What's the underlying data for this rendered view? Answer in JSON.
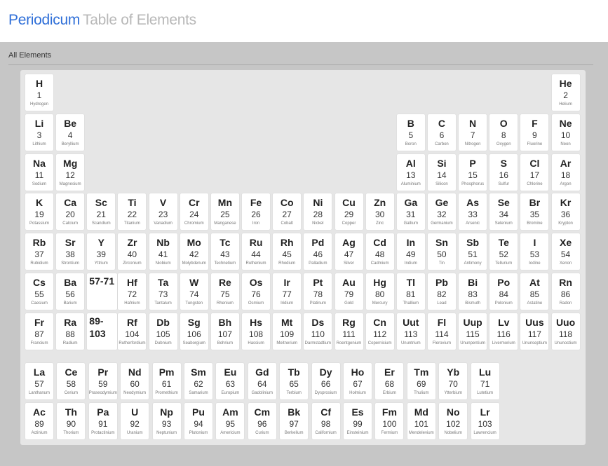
{
  "header": {
    "title": "Periodicum",
    "subtitle": "Table of Elements"
  },
  "section": {
    "title": "All Elements"
  },
  "elements": [
    [
      "H",
      1,
      "Hydrogen",
      1,
      1
    ],
    [
      "He",
      2,
      "Helium",
      1,
      18
    ],
    [
      "Li",
      3,
      "Lithium",
      2,
      1
    ],
    [
      "Be",
      4,
      "Beryllium",
      2,
      2
    ],
    [
      "B",
      5,
      "Boron",
      2,
      13
    ],
    [
      "C",
      6,
      "Carbon",
      2,
      14
    ],
    [
      "N",
      7,
      "Nitrogen",
      2,
      15
    ],
    [
      "O",
      8,
      "Oxygen",
      2,
      16
    ],
    [
      "F",
      9,
      "Fluorine",
      2,
      17
    ],
    [
      "Ne",
      10,
      "Neon",
      2,
      18
    ],
    [
      "Na",
      11,
      "Sodium",
      3,
      1
    ],
    [
      "Mg",
      12,
      "Magnesium",
      3,
      2
    ],
    [
      "Al",
      13,
      "Aluminium",
      3,
      13
    ],
    [
      "Si",
      14,
      "Silicon",
      3,
      14
    ],
    [
      "P",
      15,
      "Phosphorus",
      3,
      15
    ],
    [
      "S",
      16,
      "Sulfur",
      3,
      16
    ],
    [
      "Cl",
      17,
      "Chlorine",
      3,
      17
    ],
    [
      "Ar",
      18,
      "Argon",
      3,
      18
    ],
    [
      "K",
      19,
      "Potassium",
      4,
      1
    ],
    [
      "Ca",
      20,
      "Calcium",
      4,
      2
    ],
    [
      "Sc",
      21,
      "Scandium",
      4,
      3
    ],
    [
      "Ti",
      22,
      "Titanium",
      4,
      4
    ],
    [
      "V",
      23,
      "Vanadium",
      4,
      5
    ],
    [
      "Cr",
      24,
      "Chromium",
      4,
      6
    ],
    [
      "Mn",
      25,
      "Manganese",
      4,
      7
    ],
    [
      "Fe",
      26,
      "Iron",
      4,
      8
    ],
    [
      "Co",
      27,
      "Cobalt",
      4,
      9
    ],
    [
      "Ni",
      28,
      "Nickel",
      4,
      10
    ],
    [
      "Cu",
      29,
      "Copper",
      4,
      11
    ],
    [
      "Zn",
      30,
      "Zinc",
      4,
      12
    ],
    [
      "Ga",
      31,
      "Gallium",
      4,
      13
    ],
    [
      "Ge",
      32,
      "Germanium",
      4,
      14
    ],
    [
      "As",
      33,
      "Arsenic",
      4,
      15
    ],
    [
      "Se",
      34,
      "Selenium",
      4,
      16
    ],
    [
      "Br",
      35,
      "Bromine",
      4,
      17
    ],
    [
      "Kr",
      36,
      "Krypton",
      4,
      18
    ],
    [
      "Rb",
      37,
      "Rubidium",
      5,
      1
    ],
    [
      "Sr",
      38,
      "Strontium",
      5,
      2
    ],
    [
      "Y",
      39,
      "Yttrium",
      5,
      3
    ],
    [
      "Zr",
      40,
      "Zirconium",
      5,
      4
    ],
    [
      "Nb",
      41,
      "Niobium",
      5,
      5
    ],
    [
      "Mo",
      42,
      "Molybdenum",
      5,
      6
    ],
    [
      "Tc",
      43,
      "Technetium",
      5,
      7
    ],
    [
      "Ru",
      44,
      "Ruthenium",
      5,
      8
    ],
    [
      "Rh",
      45,
      "Rhodium",
      5,
      9
    ],
    [
      "Pd",
      46,
      "Palladium",
      5,
      10
    ],
    [
      "Ag",
      47,
      "Silver",
      5,
      11
    ],
    [
      "Cd",
      48,
      "Cadmium",
      5,
      12
    ],
    [
      "In",
      49,
      "Indium",
      5,
      13
    ],
    [
      "Sn",
      50,
      "Tin",
      5,
      14
    ],
    [
      "Sb",
      51,
      "Antimony",
      5,
      15
    ],
    [
      "Te",
      52,
      "Tellurium",
      5,
      16
    ],
    [
      "I",
      53,
      "Iodine",
      5,
      17
    ],
    [
      "Xe",
      54,
      "Xenon",
      5,
      18
    ],
    [
      "Cs",
      55,
      "Caesium",
      6,
      1
    ],
    [
      "Ba",
      56,
      "Barium",
      6,
      2
    ],
    [
      "Hf",
      72,
      "Hafnium",
      6,
      4
    ],
    [
      "Ta",
      73,
      "Tantalum",
      6,
      5
    ],
    [
      "W",
      74,
      "Tungsten",
      6,
      6
    ],
    [
      "Re",
      75,
      "Rhenium",
      6,
      7
    ],
    [
      "Os",
      76,
      "Osmium",
      6,
      8
    ],
    [
      "Ir",
      77,
      "Iridium",
      6,
      9
    ],
    [
      "Pt",
      78,
      "Platinum",
      6,
      10
    ],
    [
      "Au",
      79,
      "Gold",
      6,
      11
    ],
    [
      "Hg",
      80,
      "Mercury",
      6,
      12
    ],
    [
      "Tl",
      81,
      "Thallium",
      6,
      13
    ],
    [
      "Pb",
      82,
      "Lead",
      6,
      14
    ],
    [
      "Bi",
      83,
      "Bismuth",
      6,
      15
    ],
    [
      "Po",
      84,
      "Polonium",
      6,
      16
    ],
    [
      "At",
      85,
      "Astatine",
      6,
      17
    ],
    [
      "Rn",
      86,
      "Radon",
      6,
      18
    ],
    [
      "Fr",
      87,
      "Francium",
      7,
      1
    ],
    [
      "Ra",
      88,
      "Radium",
      7,
      2
    ],
    [
      "Rf",
      104,
      "Rutherfordium",
      7,
      4
    ],
    [
      "Db",
      105,
      "Dubnium",
      7,
      5
    ],
    [
      "Sg",
      106,
      "Seaborgium",
      7,
      6
    ],
    [
      "Bh",
      107,
      "Bohrium",
      7,
      7
    ],
    [
      "Hs",
      108,
      "Hassium",
      7,
      8
    ],
    [
      "Mt",
      109,
      "Meitnerium",
      7,
      9
    ],
    [
      "Ds",
      110,
      "Darmstadtium",
      7,
      10
    ],
    [
      "Rg",
      111,
      "Roentgenium",
      7,
      11
    ],
    [
      "Cn",
      112,
      "Copernicium",
      7,
      12
    ],
    [
      "Uut",
      113,
      "Ununtrium",
      7,
      13
    ],
    [
      "Fl",
      114,
      "Flerovium",
      7,
      14
    ],
    [
      "Uup",
      115,
      "Ununpentium",
      7,
      15
    ],
    [
      "Lv",
      116,
      "Livermorium",
      7,
      16
    ],
    [
      "Uus",
      117,
      "Ununseptium",
      7,
      17
    ],
    [
      "Uuo",
      118,
      "Ununoctium",
      7,
      18
    ],
    [
      "La",
      57,
      "Lanthanum",
      8,
      1
    ],
    [
      "Ce",
      58,
      "Cerium",
      8,
      2
    ],
    [
      "Pr",
      59,
      "Praseodymium",
      8,
      3
    ],
    [
      "Nd",
      60,
      "Neodymium",
      8,
      4
    ],
    [
      "Pm",
      61,
      "Promethium",
      8,
      5
    ],
    [
      "Sm",
      62,
      "Samarium",
      8,
      6
    ],
    [
      "Eu",
      63,
      "Europium",
      8,
      7
    ],
    [
      "Gd",
      64,
      "Gadolinium",
      8,
      8
    ],
    [
      "Tb",
      65,
      "Terbium",
      8,
      9
    ],
    [
      "Dy",
      66,
      "Dysprosium",
      8,
      10
    ],
    [
      "Ho",
      67,
      "Holmium",
      8,
      11
    ],
    [
      "Er",
      68,
      "Erbium",
      8,
      12
    ],
    [
      "Tm",
      69,
      "Thulium",
      8,
      13
    ],
    [
      "Yb",
      70,
      "Ytterbium",
      8,
      14
    ],
    [
      "Lu",
      71,
      "Lutetium",
      8,
      15
    ],
    [
      "Ac",
      89,
      "Actinium",
      9,
      1
    ],
    [
      "Th",
      90,
      "Thorium",
      9,
      2
    ],
    [
      "Pa",
      91,
      "Protactinium",
      9,
      3
    ],
    [
      "U",
      92,
      "Uranium",
      9,
      4
    ],
    [
      "Np",
      93,
      "Neptunium",
      9,
      5
    ],
    [
      "Pu",
      94,
      "Plutonium",
      9,
      6
    ],
    [
      "Am",
      95,
      "Americium",
      9,
      7
    ],
    [
      "Cm",
      96,
      "Curium",
      9,
      8
    ],
    [
      "Bk",
      97,
      "Berkelium",
      9,
      9
    ],
    [
      "Cf",
      98,
      "Californium",
      9,
      10
    ],
    [
      "Es",
      99,
      "Einsteinium",
      9,
      11
    ],
    [
      "Fm",
      100,
      "Fermium",
      9,
      12
    ],
    [
      "Md",
      101,
      "Mendelevium",
      9,
      13
    ],
    [
      "No",
      102,
      "Nobelium",
      9,
      14
    ],
    [
      "Lr",
      103,
      "Lawrencium",
      9,
      15
    ]
  ],
  "placeholders": [
    {
      "label": "57-71",
      "row": 6,
      "col": 3
    },
    {
      "label": "89-103",
      "row": 7,
      "col": 3
    }
  ]
}
